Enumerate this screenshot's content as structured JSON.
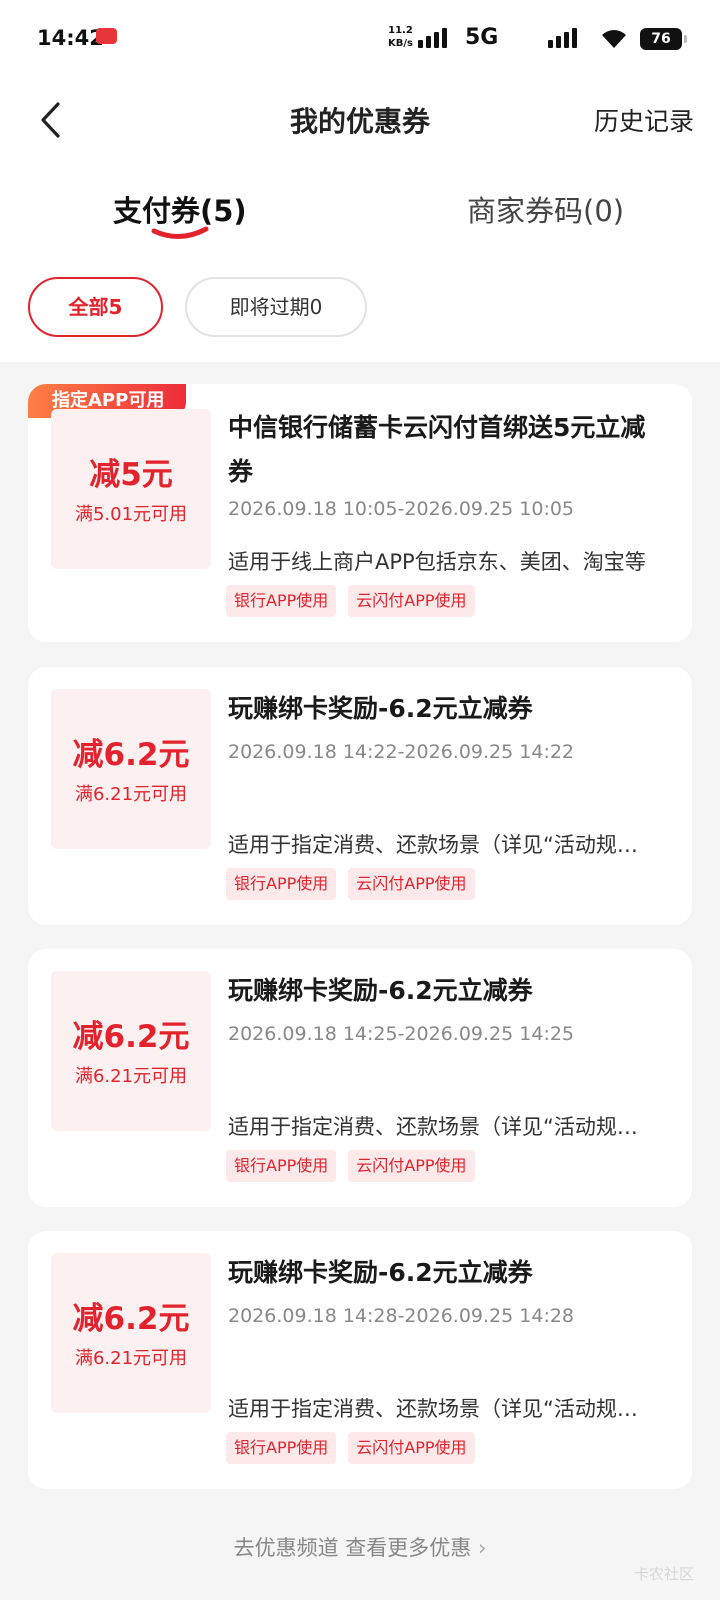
{
  "status": {
    "time": "14:42",
    "speed_value": "11.2",
    "speed_unit": "KB/s",
    "network": "5G",
    "battery": "76"
  },
  "header": {
    "title": "我的优惠券",
    "history": "历史记录",
    "back_icon": "chevron-left-icon"
  },
  "tabs": [
    {
      "label": "支付券(5)",
      "active": true
    },
    {
      "label": "商家券码(0)",
      "active": false
    }
  ],
  "filters": [
    {
      "label": "全部5",
      "active": true
    },
    {
      "label": "即将过期0",
      "active": false
    }
  ],
  "coupons": [
    {
      "tag": "指定APP可用",
      "amount": "减5元",
      "min_spend": "满5.01元可用",
      "title": "中信银行储蓄卡云闪付首绑送5元立减券",
      "date": "2026.09.18 10:05-2026.09.25 10:05",
      "desc": "适用于线上商户APP包括京东、美团、淘宝等",
      "scenes": [
        "银行APP使用",
        "云闪付APP使用"
      ]
    },
    {
      "tag": "",
      "amount": "减6.2元",
      "min_spend": "满6.21元可用",
      "title": "玩赚绑卡奖励-6.2元立减券",
      "date": "2026.09.18 14:22-2026.09.25 14:22",
      "desc": "适用于指定消费、还款场景（详见“活动规则”）",
      "scenes": [
        "银行APP使用",
        "云闪付APP使用"
      ]
    },
    {
      "tag": "",
      "amount": "减6.2元",
      "min_spend": "满6.21元可用",
      "title": "玩赚绑卡奖励-6.2元立减券",
      "date": "2026.09.18 14:25-2026.09.25 14:25",
      "desc": "适用于指定消费、还款场景（详见“活动规则”）",
      "scenes": [
        "银行APP使用",
        "云闪付APP使用"
      ]
    },
    {
      "tag": "",
      "amount": "减6.2元",
      "min_spend": "满6.21元可用",
      "title": "玩赚绑卡奖励-6.2元立减券",
      "date": "2026.09.18 14:28-2026.09.25 14:28",
      "desc": "适用于指定消费、还款场景（详见“活动规则”）",
      "scenes": [
        "银行APP使用",
        "云闪付APP使用"
      ]
    }
  ],
  "footer": {
    "more": "去优惠频道 查看更多优惠",
    "watermark": "卡农社区"
  },
  "colors": {
    "accent": "#e2232e",
    "tag_gradient_start": "#ff7e45",
    "tag_gradient_end": "#ee2c3b",
    "amount_bg": "#fdf0f0",
    "page_bg": "#f5f5f5"
  }
}
